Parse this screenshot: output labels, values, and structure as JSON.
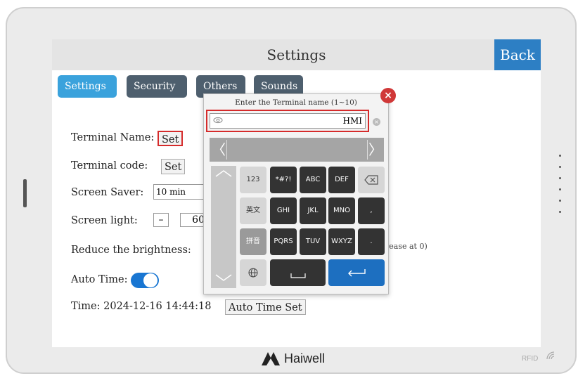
{
  "header": {
    "title": "Settings",
    "back_label": "Back"
  },
  "tabs": [
    {
      "label": "Settings",
      "active": true
    },
    {
      "label": "Security"
    },
    {
      "label": "Others"
    },
    {
      "label": "Sounds"
    }
  ],
  "settings": {
    "terminal_name_label": "Terminal Name:",
    "terminal_name_button": "Set",
    "terminal_code_label": "Terminal code:",
    "terminal_code_button": "Set",
    "screen_saver_label": "Screen Saver:",
    "screen_saver_value": "10 min",
    "screen_light_label": "Screen light:",
    "screen_light_minus": "–",
    "screen_light_value": "60",
    "reduce_brightness_label": "Reduce the brightness:",
    "reduce_brightness_hint": "rease at 0)",
    "auto_time_label": "Auto Time:",
    "auto_time_on": true,
    "time_label": "Time: 2024-12-16 14:44:18",
    "auto_time_set_button": "Auto Time Set"
  },
  "keyboard": {
    "prompt": "Enter the Terminal name (1~10)",
    "input_value": "HMI",
    "close_icon": "×",
    "clear_icon": "×",
    "prev_icon": "〈",
    "next_icon": "〉",
    "keys": {
      "k123": "123",
      "symbols": "*#?!",
      "abc": "ABC",
      "def": "DEF",
      "english": "英文",
      "ghi": "GHI",
      "jkl": "JKL",
      "mno": "MNO",
      "comma": ",",
      "pinyin": "拼音",
      "pqrs": "PQRS",
      "tuv": "TUV",
      "wxyz": "WXYZ",
      "period": "."
    }
  },
  "brand": {
    "name": "Haiwell",
    "rfid": "RFID"
  },
  "colors": {
    "accent": "#3aa2dc",
    "back_button": "#2d7fc4",
    "highlight": "#d52b2b",
    "toggle": "#1976d2"
  }
}
